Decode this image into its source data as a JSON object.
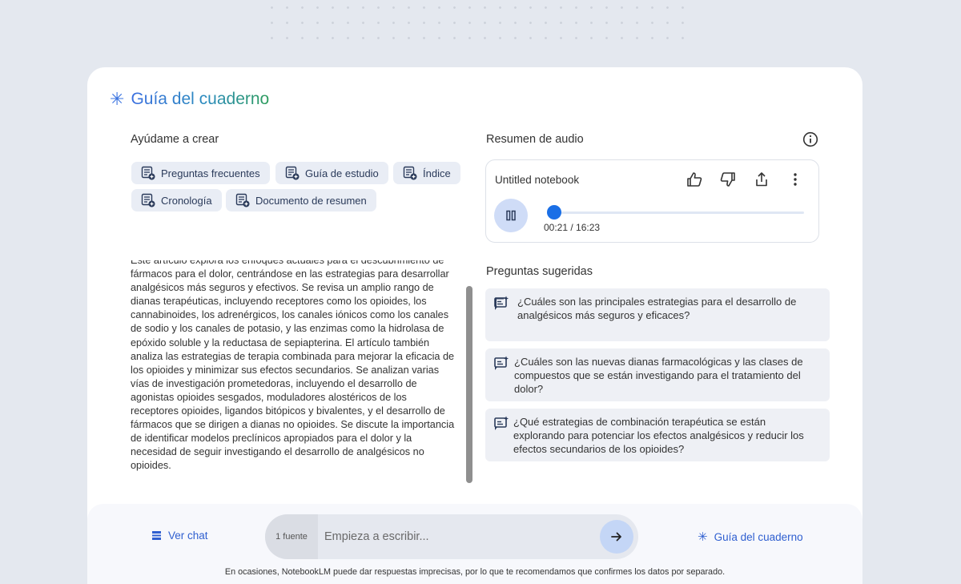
{
  "guide": {
    "title": "Guía del cuaderno"
  },
  "help": {
    "label": "Ayúdame a crear",
    "chips": [
      "Preguntas frecuentes",
      "Guía de estudio",
      "Índice",
      "Cronología",
      "Documento de resumen"
    ]
  },
  "summary": {
    "text": "Este artículo explora los enfoques actuales para el descubrimiento de fármacos para el dolor, centrándose en las estrategias para desarrollar analgésicos más seguros y efectivos. Se revisa un amplio rango de dianas terapéuticas, incluyendo receptores como los opioides, los cannabinoides, los adrenérgicos, los canales iónicos como los canales de sodio y los canales de potasio, y las enzimas como la hidrolasa de epóxido soluble y la reductasa de sepiapterina. El artículo también analiza las estrategias de terapia combinada para mejorar la eficacia de los opioides y minimizar sus efectos secundarios. Se analizan varias vías de investigación prometedoras, incluyendo el desarrollo de agonistas opioides sesgados, moduladores alostéricos de los receptores opioides, ligandos bitópicos y bivalentes, y el desarrollo de fármacos que se dirigen a dianas no opioides. Se discute la importancia de identificar modelos preclínicos apropiados para el dolor y la necesidad de seguir investigando el desarrollo de analgésicos no opioides."
  },
  "audio": {
    "label": "Resumen de audio",
    "notebook_title": "Untitled notebook",
    "time": "00:21 / 16:23",
    "progress": 0.0215
  },
  "suggested": {
    "label": "Preguntas sugeridas",
    "questions": [
      "¿Cuáles son las principales estrategias para el desarrollo de analgésicos más seguros y eficaces?",
      "¿Cuáles son las nuevas dianas farmacológicas y las clases de compuestos que se están investigando para el tratamiento del dolor?",
      "¿Qué estrategias de combinación terapéutica se están explorando para potenciar los efectos analgésicos y reducir los efectos secundarios de los opioides?"
    ]
  },
  "bottom": {
    "view_chat": "Ver chat",
    "source_count": "1 fuente",
    "input_placeholder": "Empieza a escribir...",
    "guide_link": "Guía del cuaderno",
    "disclaimer": "En ocasiones, NotebookLM puede dar respuestas imprecisas, por lo que te recomendamos que confirmes los datos por separado."
  },
  "colors": {
    "accent": "#1a6fe6",
    "link": "#2f5fd0",
    "chip_bg": "#e9edf5",
    "question_bg": "#eef0f5"
  }
}
